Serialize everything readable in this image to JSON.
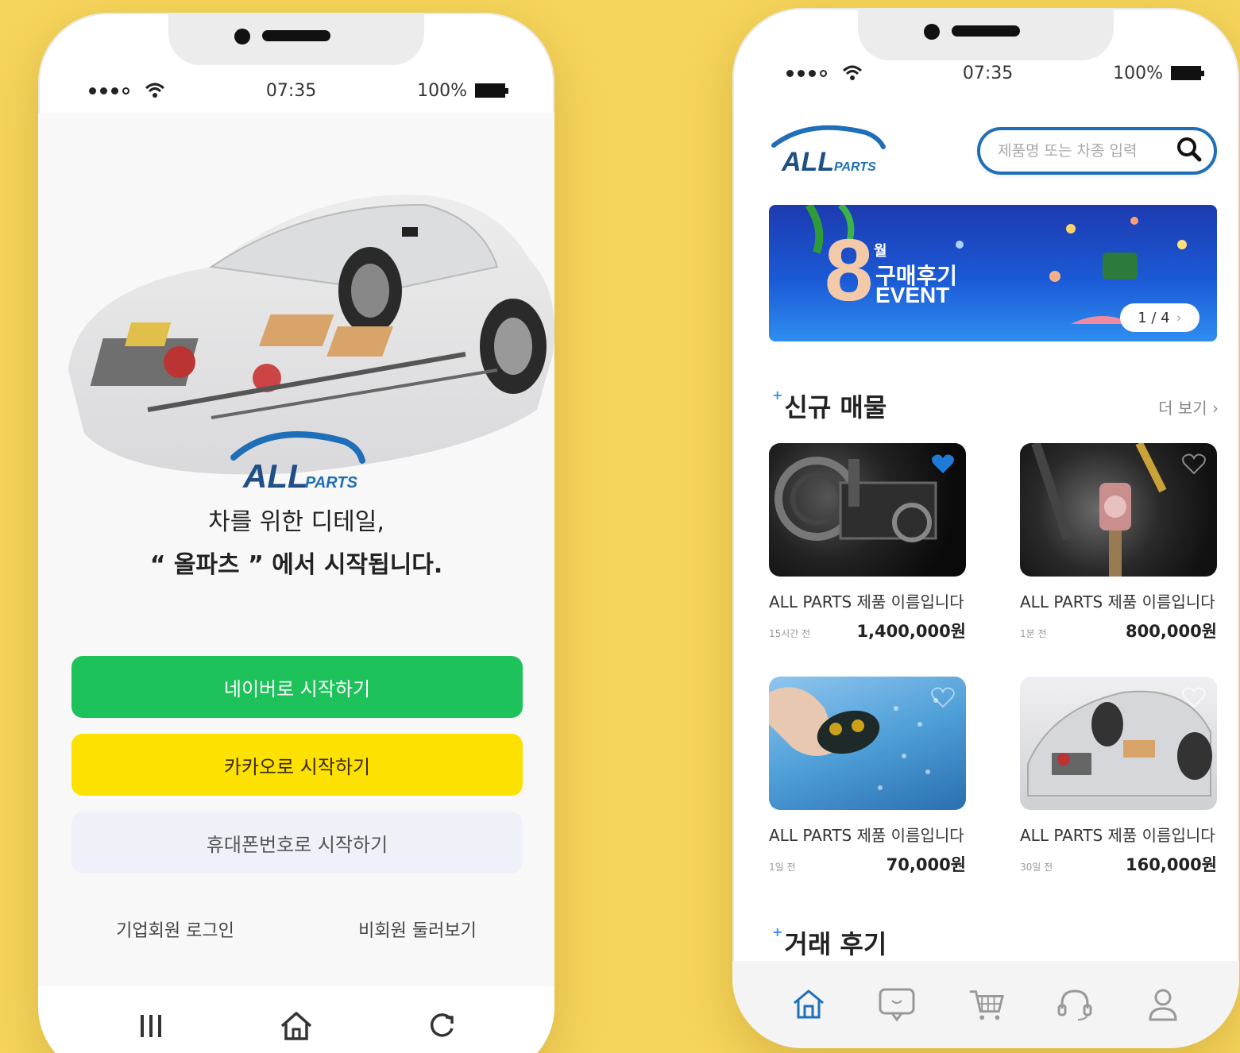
{
  "left_phone": {
    "status": {
      "time": "07:35",
      "battery": "100%"
    },
    "brand": {
      "logo_main": "ALL",
      "logo_sub": "PARTS"
    },
    "tagline": {
      "line1": "차를 위한 디테일,",
      "line2": "“ 올파츠 ” 에서 시작됩니다."
    },
    "buttons": {
      "naver": "네이버로 시작하기",
      "kakao": "카카오로 시작하기",
      "phone": "휴대폰번호로 시작하기"
    },
    "links": {
      "corporate_login": "기업회원 로그인",
      "guest_browse": "비회원 둘러보기"
    },
    "nav_icons": [
      "menu-icon",
      "home-icon",
      "refresh-icon"
    ],
    "colors": {
      "naver": "#1dc25a",
      "kakao": "#fde100",
      "phone_bg": "#eef2f8"
    }
  },
  "right_phone": {
    "status": {
      "time": "07:35",
      "battery": "100%"
    },
    "brand": {
      "logo_main": "ALL",
      "logo_sub": "PARTS"
    },
    "search": {
      "placeholder": "제품명 또는 차종 입력"
    },
    "banner": {
      "number": "8",
      "month": "월",
      "title_line1": "구매후기",
      "title_line2": "EVENT",
      "pager": "1 / 4"
    },
    "section_new": {
      "title": "신규 매물",
      "more": "더 보기"
    },
    "products": [
      {
        "name": "ALL PARTS 제품 이름입니다",
        "ago": "15시간 전",
        "price": "1,400,000원",
        "liked": true
      },
      {
        "name": "ALL PARTS 제품 이름입니다",
        "ago": "1분 전",
        "price": "800,000원",
        "liked": false
      },
      {
        "name": "ALL PARTS 제품 이름입니다",
        "ago": "1일 전",
        "price": "70,000원",
        "liked": false
      },
      {
        "name": "ALL PARTS 제품 이름입니다",
        "ago": "30일 전",
        "price": "160,000원",
        "liked": false
      }
    ],
    "section_review": {
      "title": "거래 후기"
    },
    "nav_icons": [
      "home-icon",
      "chat-icon",
      "cart-icon",
      "support-icon",
      "profile-icon"
    ],
    "colors": {
      "accent": "#1f6fb8",
      "heart": "#1f7ad8"
    }
  }
}
